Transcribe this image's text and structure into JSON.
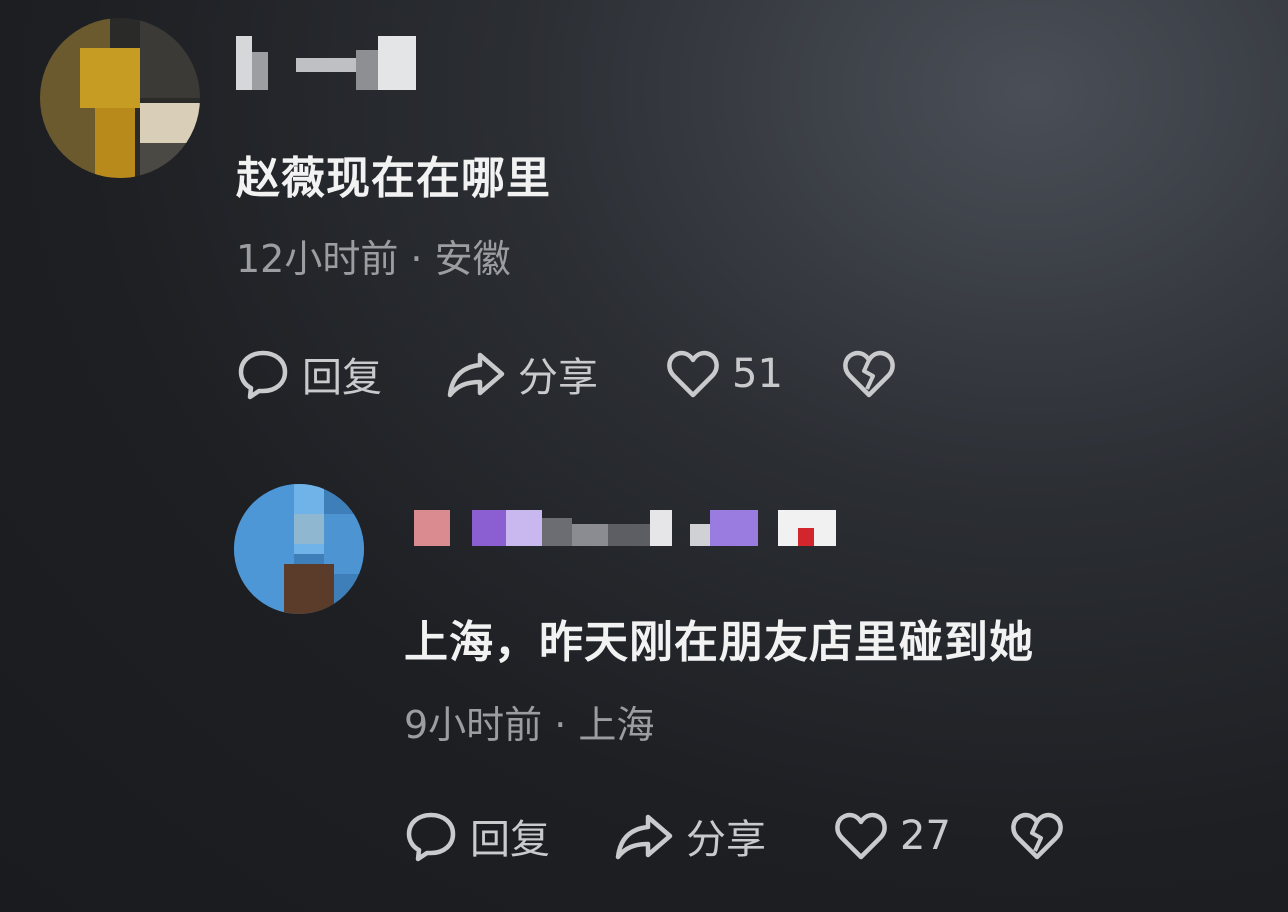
{
  "comments": [
    {
      "text": "赵薇现在在哪里",
      "meta": "12小时前 · 安徽",
      "reply_label": "回复",
      "share_label": "分享",
      "likes": "51"
    },
    {
      "text": "上海，昨天刚在朋友店里碰到她",
      "meta": "9小时前 · 上海",
      "reply_label": "回复",
      "share_label": "分享",
      "likes": "27"
    }
  ],
  "icons": {
    "reply": "reply-bubble-icon",
    "share": "share-arrow-icon",
    "like": "heart-icon",
    "dislike": "broken-heart-icon"
  },
  "colors": {
    "text_primary": "#f2f2f2",
    "text_secondary": "#9b9da1",
    "icon": "#c9cacc"
  }
}
